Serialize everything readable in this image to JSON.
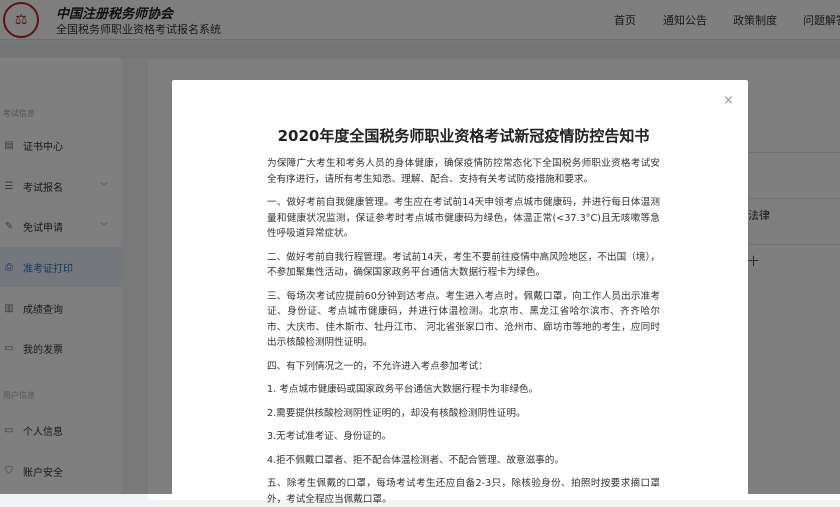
{
  "header": {
    "brand": "中国注册税务师协会",
    "system": "全国税务师职业资格考试报名系统",
    "nav": [
      "首页",
      "通知公告",
      "政策制度",
      "问题解答"
    ]
  },
  "sidebar": {
    "sections": [
      {
        "title": "考试信息",
        "items": [
          {
            "label": "证书中心",
            "icon": "certificate-icon"
          },
          {
            "label": "考试报名",
            "icon": "document-icon",
            "chevron": true
          },
          {
            "label": "免试申请",
            "icon": "edit-document-icon",
            "chevron": true
          },
          {
            "label": "准考证打印",
            "icon": "printer-icon",
            "active": true
          },
          {
            "label": "成绩查询",
            "icon": "search-document-icon"
          },
          {
            "label": "我的发票",
            "icon": "ticket-icon"
          }
        ]
      },
      {
        "title": "用户信息",
        "items": [
          {
            "label": "个人信息",
            "icon": "id-card-icon"
          },
          {
            "label": "账户安全",
            "icon": "shield-icon"
          }
        ]
      }
    ]
  },
  "background_rows": [
    "法律",
    "十"
  ],
  "modal": {
    "title": "2020年度全国税务师职业资格考试新冠疫情防控告知书",
    "close": "×",
    "paragraphs": [
      "为保障广大考生和考务人员的身体健康，确保疫情防控常态化下全国税务师职业资格考试安全有序进行，请所有考生知悉、理解、配合、支持有关考试防疫措施和要求。",
      "一、做好考前自我健康管理。考生应在考试前14天申领考点城市健康码，并进行每日体温测量和健康状况监测，保证参考时考点城市健康码为绿色，体温正常(<37.3°C)且无咳嗽等急性呼吸道异常症状。",
      "二、做好考前自我行程管理。考试前14天，考生不要前往疫情中高风险地区，不出国（境），不参加聚集性活动，确保国家政务平台通信大数据行程卡为绿色。",
      "三、每场次考试应提前60分钟到达考点。考生进入考点时，佩戴口罩，向工作人员出示准考证、身份证、考点城市健康码，并进行体温检测。北京市、黑龙江省哈尔滨市、齐齐哈尔市、大庆市、佳木斯市、牡丹江市、 河北省张家口市、沧州市、廊坊市等地的考生，应同时出示核酸检测阴性证明。",
      "四、有下列情况之一的，不允许进入考点参加考试：",
      "1. 考点城市健康码或国家政务平台通信大数据行程卡为非绿色。",
      "2.需要提供核酸检测阴性证明的，却没有核酸检测阴性证明。",
      "3.无考试准考证、身份证的。",
      "4.拒不佩戴口罩者、拒不配合体温检测者、不配合管理、故意滋事的。",
      "五、除考生佩戴的口罩，每场考试考生还应自备2-3只，除核验身份、拍照时按要求摘口罩外，考试全程应当佩戴口罩。"
    ]
  }
}
